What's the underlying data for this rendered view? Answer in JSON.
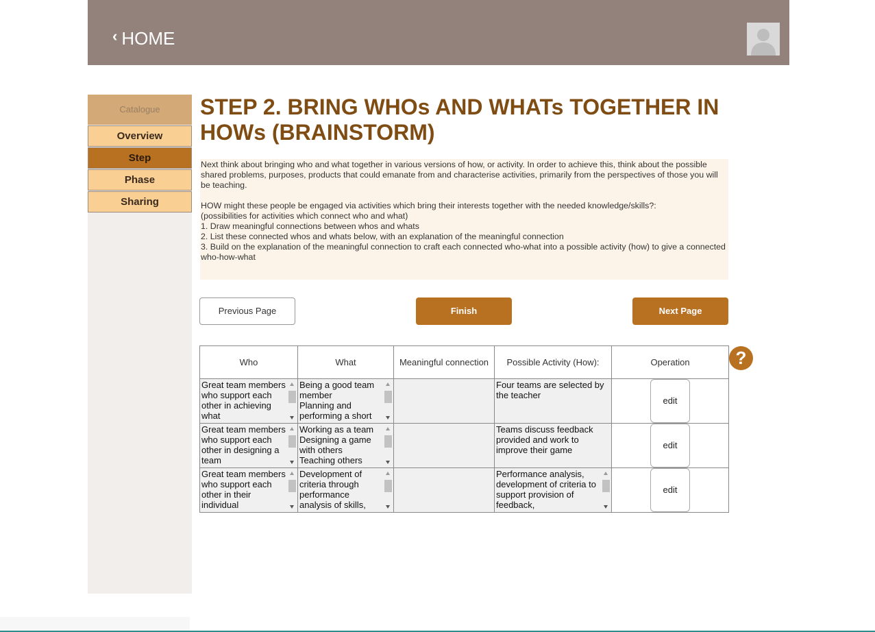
{
  "header": {
    "home_label": "HOME",
    "home_chevron": "‹"
  },
  "sidebar": {
    "catalogue": "Catalogue",
    "items": [
      {
        "label": "Overview",
        "active": false
      },
      {
        "label": "Step",
        "active": true
      },
      {
        "label": "Phase",
        "active": false
      },
      {
        "label": "Sharing",
        "active": false
      }
    ]
  },
  "main": {
    "title_line1": "STEP 2. BRING WHOs AND WHATs TOGETHER IN",
    "title_line2": "HOWs (BRAINSTORM)",
    "description": {
      "para1": "Next think about bringing who and what together in various versions of how, or activity. In order to achieve this, think about the possible shared problems, purposes, products that could emanate from and characterise activities, primarily from the perspectives of those you will be teaching.",
      "para2_l1": "HOW might these people be engaged via activities which bring their interests together with the needed knowledge/skills?:",
      "para2_l2": "(possibilities for activities which connect who and what)",
      "para2_l3": "1. Draw meaningful connections between whos and whats",
      "para2_l4": "2. List these connected whos and whats below, with an explanation of the meaningful connection",
      "para2_l5": "3. Build on the explanation of the meaningful connection to craft each connected who-what into a possible activity (how) to give a connected who-how-what"
    },
    "buttons": {
      "previous": "Previous Page",
      "finish": "Finish",
      "next": "Next Page"
    },
    "help_symbol": "?"
  },
  "table": {
    "headers": [
      "Who",
      "What",
      "Meaningful connection",
      "Possible Activity (How):",
      "Operation"
    ],
    "rows": [
      {
        "who": "Great team members who support each other in achieving what",
        "what": "Being a good team member\nPlanning and performing a short",
        "connection": "",
        "activity": "Four teams are selected by the teacher",
        "operation": "edit"
      },
      {
        "who": "Great team members who support each other in designing a team",
        "what": "Working as a team\nDesigning a game with others\nTeaching others",
        "connection": "",
        "activity": "Teams discuss feedback provided and work to improve their game",
        "operation": "edit"
      },
      {
        "who": "Great team members who support each other in their individual",
        "what": "Development of criteria through performance analysis of skills,",
        "connection": "",
        "activity": "Performance analysis, development of criteria to support provision of feedback,",
        "operation": "edit"
      }
    ]
  },
  "colors": {
    "header_bg": "#92827b",
    "accent": "#b87021",
    "title": "#7f4d14",
    "nav_bg": "#f9cf93",
    "catalogue_bg": "#d3a978",
    "desc_bg": "#fdf4e9"
  },
  "icons": {
    "avatar": "user-avatar-icon",
    "help": "question-circle-icon",
    "back": "chevron-left-icon"
  }
}
